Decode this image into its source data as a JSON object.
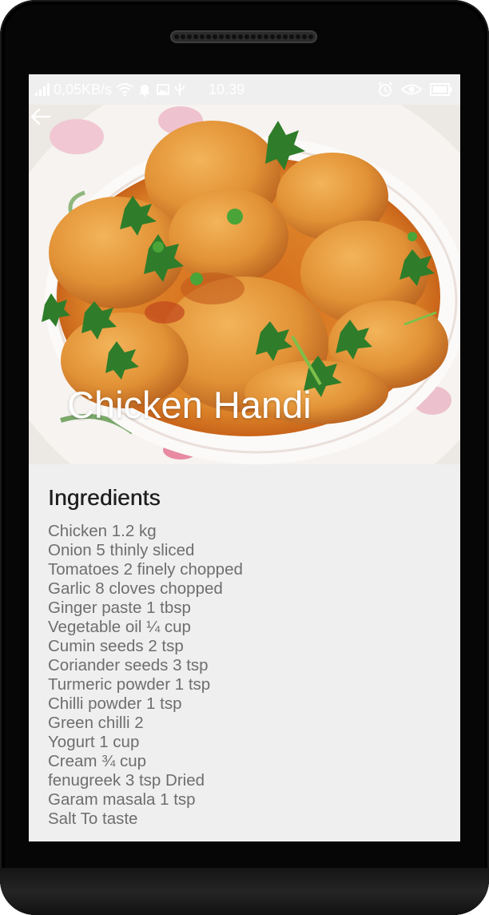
{
  "status_bar": {
    "network_speed": "0,05KB/s",
    "time": "10.39",
    "icons": [
      "signal-icon",
      "wifi-icon",
      "bell-icon",
      "image-icon",
      "usb-icon",
      "alarm-icon",
      "eye-icon",
      "battery-icon"
    ]
  },
  "recipe": {
    "title": "Chicken Handi",
    "back_icon": "arrow-left-icon"
  },
  "ingredients": {
    "heading": "Ingredients",
    "items": [
      "Chicken 1.2 kg",
      "Onion 5 thinly sliced",
      "Tomatoes 2 finely chopped",
      "Garlic 8 cloves chopped",
      "Ginger paste 1 tbsp",
      "Vegetable oil ¼ cup",
      "Cumin seeds 2 tsp",
      "Coriander seeds 3 tsp",
      "Turmeric powder 1 tsp",
      "Chilli powder 1 tsp",
      "Green chilli 2",
      "Yogurt 1 cup",
      "Cream ¾ cup",
      "fenugreek 3 tsp Dried",
      "Garam masala 1 tsp",
      "Salt To taste"
    ]
  },
  "colors": {
    "background": "#efefef",
    "heading_text": "#1f1f1f",
    "body_text": "#6e6e6e",
    "curry": "#e08a2c"
  }
}
